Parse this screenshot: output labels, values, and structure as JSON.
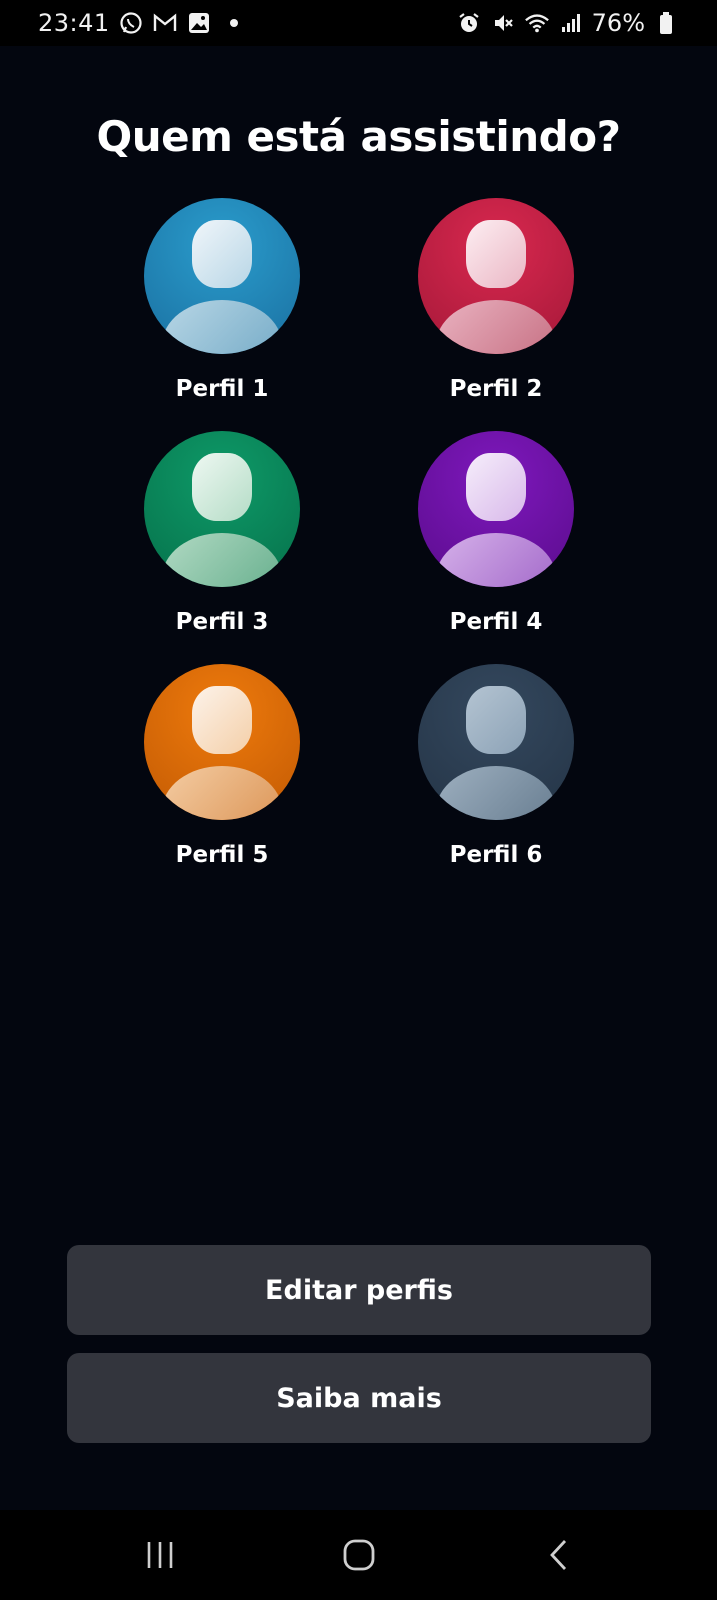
{
  "status_bar": {
    "time": "23:41",
    "left_icons": [
      "whatsapp-icon",
      "gmail-icon",
      "gallery-icon"
    ],
    "right_icons": [
      "alarm-icon",
      "mute-icon",
      "wifi-icon",
      "signal-icon",
      "battery-icon"
    ],
    "battery": "76%"
  },
  "title": "Quem está assistindo?",
  "profiles": [
    {
      "name": "Perfil 1",
      "color": "#1e86b8"
    },
    {
      "name": "Perfil 2",
      "color": "#c8224a"
    },
    {
      "name": "Perfil 3",
      "color": "#0a8a5a"
    },
    {
      "name": "Perfil 4",
      "color": "#7012a8"
    },
    {
      "name": "Perfil 5",
      "color": "#e06e08"
    },
    {
      "name": "Perfil 6",
      "color": "#2e4258"
    }
  ],
  "buttons": {
    "edit": "Editar perfis",
    "learn_more": "Saiba mais"
  },
  "nav_bar": {
    "icons": [
      "recent-apps-icon",
      "home-icon",
      "back-icon"
    ]
  }
}
